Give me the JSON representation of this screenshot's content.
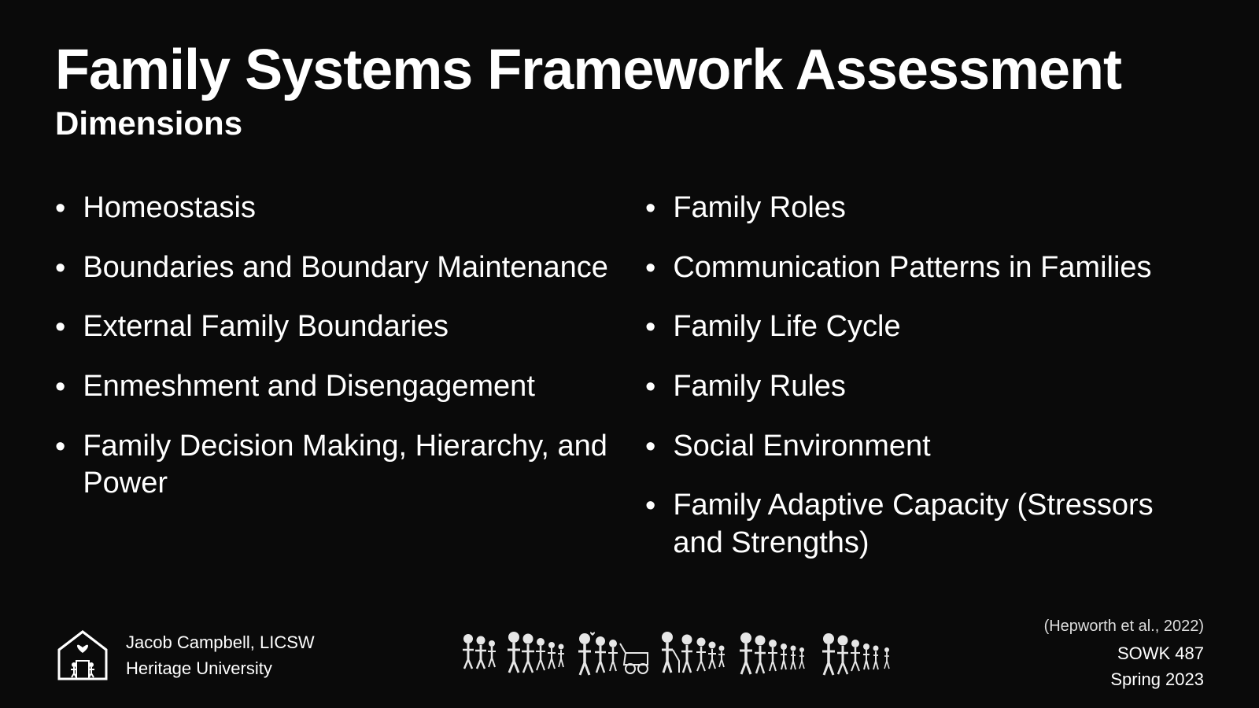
{
  "header": {
    "main_title": "Family Systems Framework Assessment",
    "subtitle": "Dimensions"
  },
  "left_column": {
    "items": [
      {
        "text": "Homeostasis"
      },
      {
        "text": "Boundaries and Boundary Maintenance"
      },
      {
        "text": "External Family Boundaries"
      },
      {
        "text": "Enmeshment and Disengagement"
      },
      {
        "text": "Family Decision Making, Hierarchy, and Power"
      }
    ]
  },
  "right_column": {
    "items": [
      {
        "text": "Family Roles"
      },
      {
        "text": "Communication Patterns in Families"
      },
      {
        "text": "Family Life Cycle"
      },
      {
        "text": "Family Rules"
      },
      {
        "text": "Social Environment"
      },
      {
        "text": "Family Adaptive Capacity (Stressors and Strengths)"
      }
    ]
  },
  "footer": {
    "author_name": "Jacob Campbell, LICSW",
    "institution": "Heritage University",
    "citation": "(Hepworth et al., 2022)",
    "course": "SOWK 487",
    "semester": "Spring 2023"
  },
  "bullet_char": "•"
}
